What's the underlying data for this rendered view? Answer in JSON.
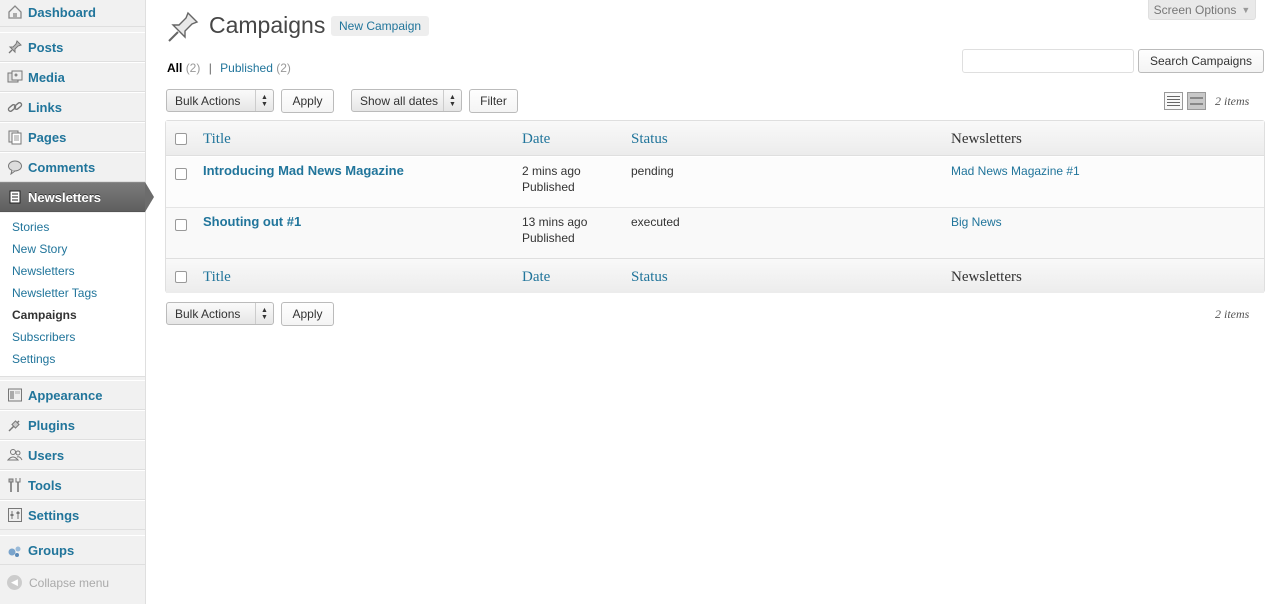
{
  "sidebar": {
    "items": [
      {
        "label": "Dashboard",
        "icon": "dashboard-icon"
      },
      {
        "label": "Posts",
        "icon": "pushpin-icon"
      },
      {
        "label": "Media",
        "icon": "media-icon"
      },
      {
        "label": "Links",
        "icon": "link-icon"
      },
      {
        "label": "Pages",
        "icon": "pages-icon"
      },
      {
        "label": "Comments",
        "icon": "comment-icon"
      },
      {
        "label": "Newsletters",
        "icon": "newsletter-icon"
      },
      {
        "label": "Appearance",
        "icon": "appearance-icon"
      },
      {
        "label": "Plugins",
        "icon": "plugin-icon"
      },
      {
        "label": "Users",
        "icon": "users-icon"
      },
      {
        "label": "Tools",
        "icon": "tools-icon"
      },
      {
        "label": "Settings",
        "icon": "settings-icon"
      },
      {
        "label": "Groups",
        "icon": "groups-icon"
      }
    ],
    "submenu": [
      "Stories",
      "New Story",
      "Newsletters",
      "Newsletter Tags",
      "Campaigns",
      "Subscribers",
      "Settings"
    ],
    "collapse": "Collapse menu"
  },
  "header": {
    "screen_options": "Screen Options",
    "title": "Campaigns",
    "add_new": "New Campaign"
  },
  "filters": {
    "all_label": "All",
    "all_count": "(2)",
    "separator": "|",
    "published_label": "Published",
    "published_count": "(2)"
  },
  "search": {
    "value": "",
    "button": "Search Campaigns"
  },
  "toolbar": {
    "bulk_actions": "Bulk Actions",
    "apply": "Apply",
    "dates": "Show all dates",
    "filter": "Filter",
    "items_count": "2 items"
  },
  "table": {
    "columns": [
      "Title",
      "Date",
      "Status",
      "Newsletters"
    ],
    "rows": [
      {
        "title": "Introducing Mad News Magazine",
        "date": "2 mins ago",
        "date_status": "Published",
        "status": "pending",
        "newsletter": "Mad News Magazine #1"
      },
      {
        "title": "Shouting out #1",
        "date": "13 mins ago",
        "date_status": "Published",
        "status": "executed",
        "newsletter": "Big News"
      }
    ]
  },
  "colors": {
    "link": "#21759b",
    "current_menu": "#6c6c6c",
    "sidebar_bg": "#f1f1f1"
  }
}
